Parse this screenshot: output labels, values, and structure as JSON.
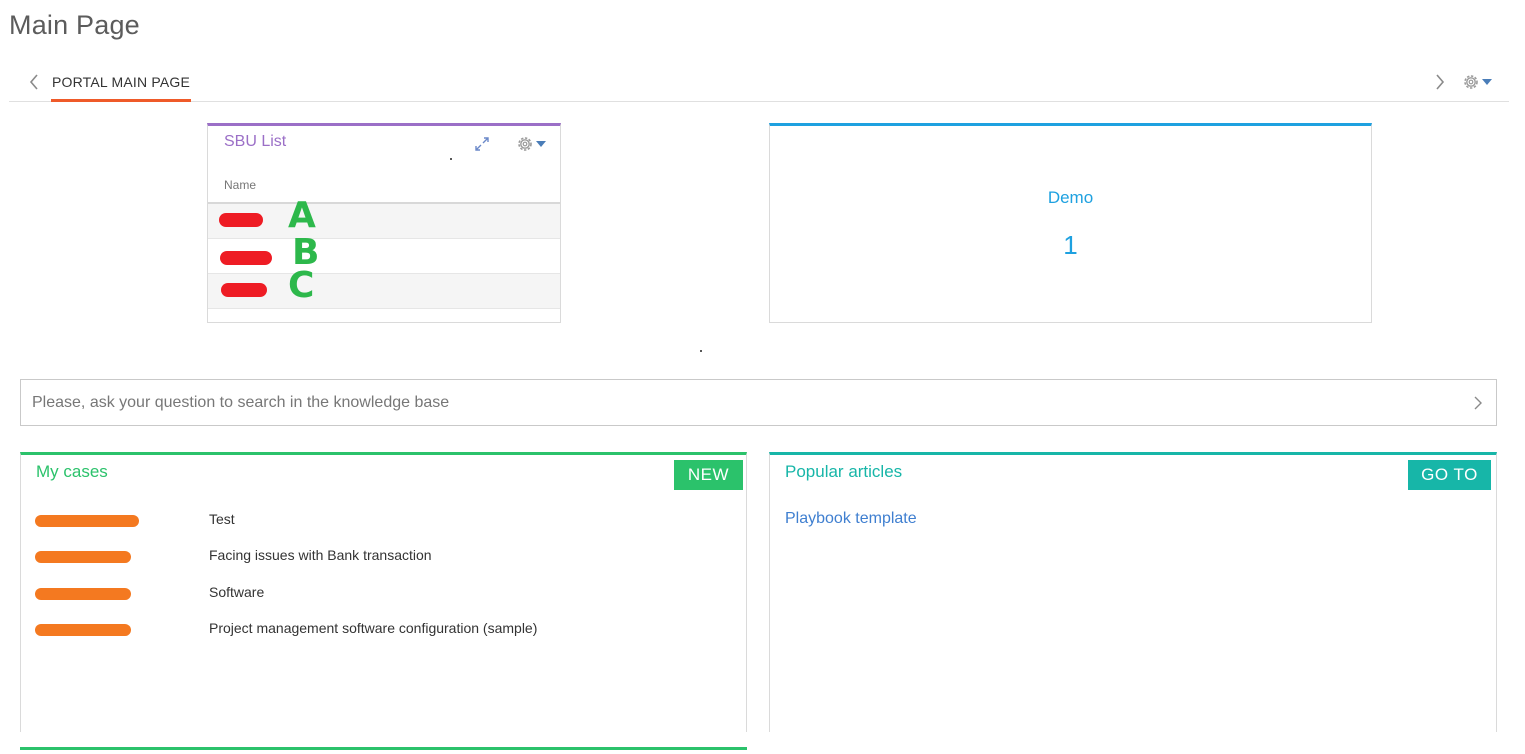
{
  "page": {
    "title": "Main Page"
  },
  "tabs": {
    "active_label": "PORTAL MAIN PAGE",
    "prev_icon": "chevron-left-icon",
    "next_icon": "chevron-right-icon",
    "settings_icon": "gear-dropdown-icon"
  },
  "sbu_widget": {
    "title": "SBU List",
    "column_header": "Name",
    "accent_color": "#9b6fc7",
    "rows": [
      {
        "annotation": "A"
      },
      {
        "annotation": "B"
      },
      {
        "annotation": "C"
      }
    ]
  },
  "demo_widget": {
    "label": "Demo",
    "value": "1",
    "accent_color": "#1ea1e0"
  },
  "search": {
    "placeholder": "Please, ask your question to search in the knowledge base",
    "value": ""
  },
  "my_cases": {
    "title": "My cases",
    "new_button": "NEW",
    "accent_color": "#2bc26b",
    "items": [
      {
        "subject": "Test"
      },
      {
        "subject": "Facing issues with Bank transaction"
      },
      {
        "subject": "Software"
      },
      {
        "subject": "Project management software configuration (sample)"
      }
    ]
  },
  "popular_articles": {
    "title": "Popular articles",
    "goto_button": "GO TO",
    "accent_color": "#17b6a8",
    "items": [
      {
        "title": "Playbook template"
      }
    ]
  },
  "redaction_colors": {
    "sbu": "#ee1c24",
    "cases": "#f47920",
    "annotations": "#2db84b"
  }
}
